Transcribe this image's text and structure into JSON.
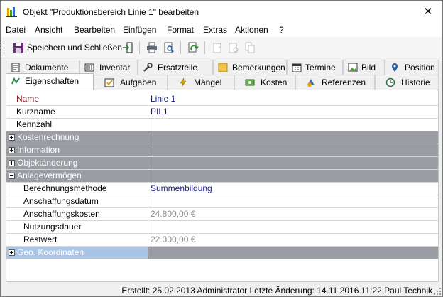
{
  "window": {
    "title": "Objekt \"Produktionsbereich Linie 1\" bearbeiten",
    "close_glyph": "✕"
  },
  "menu": [
    {
      "label": "Datei"
    },
    {
      "label": "Ansicht"
    },
    {
      "label": "Bearbeiten"
    },
    {
      "label": "Einfügen"
    },
    {
      "label": "Format"
    },
    {
      "label": "Extras"
    },
    {
      "label": "Aktionen"
    },
    {
      "label": "?"
    }
  ],
  "toolbar": {
    "save_close_label": "Speichern und Schließen",
    "icons": [
      "save-icon",
      "exit-icon",
      "print-icon",
      "print-preview-icon",
      "refresh-icon",
      "new-doc-icon",
      "settings-doc-icon",
      "copy-doc-icon"
    ]
  },
  "tabs_row1": [
    {
      "label": "Dokumente",
      "icon": "document-icon"
    },
    {
      "label": "Inventar",
      "icon": "inventory-icon"
    },
    {
      "label": "Ersatzteile",
      "icon": "spare-parts-icon"
    },
    {
      "label": "Bemerkungen",
      "icon": "notes-icon"
    },
    {
      "label": "Termine",
      "icon": "calendar-icon"
    },
    {
      "label": "Bild",
      "icon": "image-icon"
    },
    {
      "label": "Position",
      "icon": "location-icon"
    }
  ],
  "tabs_row2": [
    {
      "label": "Eigenschaften",
      "icon": "properties-icon",
      "active": true
    },
    {
      "label": "Aufgaben",
      "icon": "tasks-icon"
    },
    {
      "label": "Mängel",
      "icon": "defects-icon"
    },
    {
      "label": "Kosten",
      "icon": "costs-icon"
    },
    {
      "label": "Referenzen",
      "icon": "references-icon"
    },
    {
      "label": "Historie",
      "icon": "history-icon"
    }
  ],
  "properties": {
    "name": {
      "key": "Name",
      "value": "Linie 1"
    },
    "kurzname": {
      "key": "Kurzname",
      "value": "PIL1"
    },
    "kennzahl": {
      "key": "Kennzahl",
      "value": ""
    },
    "cat_kosten": {
      "key": "Kostenrechnung"
    },
    "cat_info": {
      "key": "Information"
    },
    "cat_objekt": {
      "key": "Objektänderung"
    },
    "cat_anlage": {
      "key": "Anlagevermögen"
    },
    "berechnung": {
      "key": "Berechnungsmethode",
      "value": "Summenbildung"
    },
    "anschaffungsdatum": {
      "key": "Anschaffungsdatum",
      "value": ""
    },
    "anschaffungskosten": {
      "key": "Anschaffungskosten",
      "value": "24.800,00 €"
    },
    "nutzungsdauer": {
      "key": "Nutzungsdauer",
      "value": ""
    },
    "restwert": {
      "key": "Restwert",
      "value": "22.300,00 €"
    },
    "cat_geo": {
      "key": "Geo. Koordinaten"
    }
  },
  "status": {
    "text": "Erstellt: 25.02.2013 Administrator  Letzte Änderung: 14.11.2016 11:22 Paul Technik"
  }
}
